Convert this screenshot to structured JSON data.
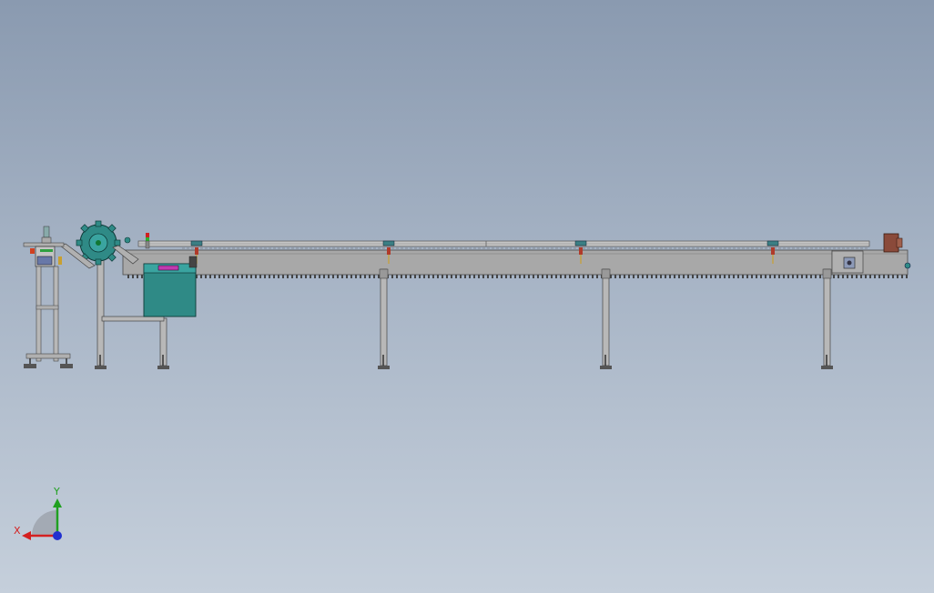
{
  "app": {
    "view": "cad-3d-viewport"
  },
  "triad": {
    "x_label": "X",
    "y_label": "Y",
    "x_color": "#d42020",
    "y_color": "#20a020",
    "z_color": "#2030d0"
  },
  "colors": {
    "background_top": "#8a9ab0",
    "background_bottom": "#c5cfdb",
    "frame": "#a8a8a8",
    "frame_dark": "#6a6a6a",
    "teal_part": "#2f8a86",
    "drive_box": "#8a4a3a",
    "indicator_magenta": "#c03ab0"
  },
  "icons": [
    "coordinate-triad-icon",
    "leveling-foot-icon",
    "sprocket-wheel-icon",
    "stack-light-icon"
  ]
}
